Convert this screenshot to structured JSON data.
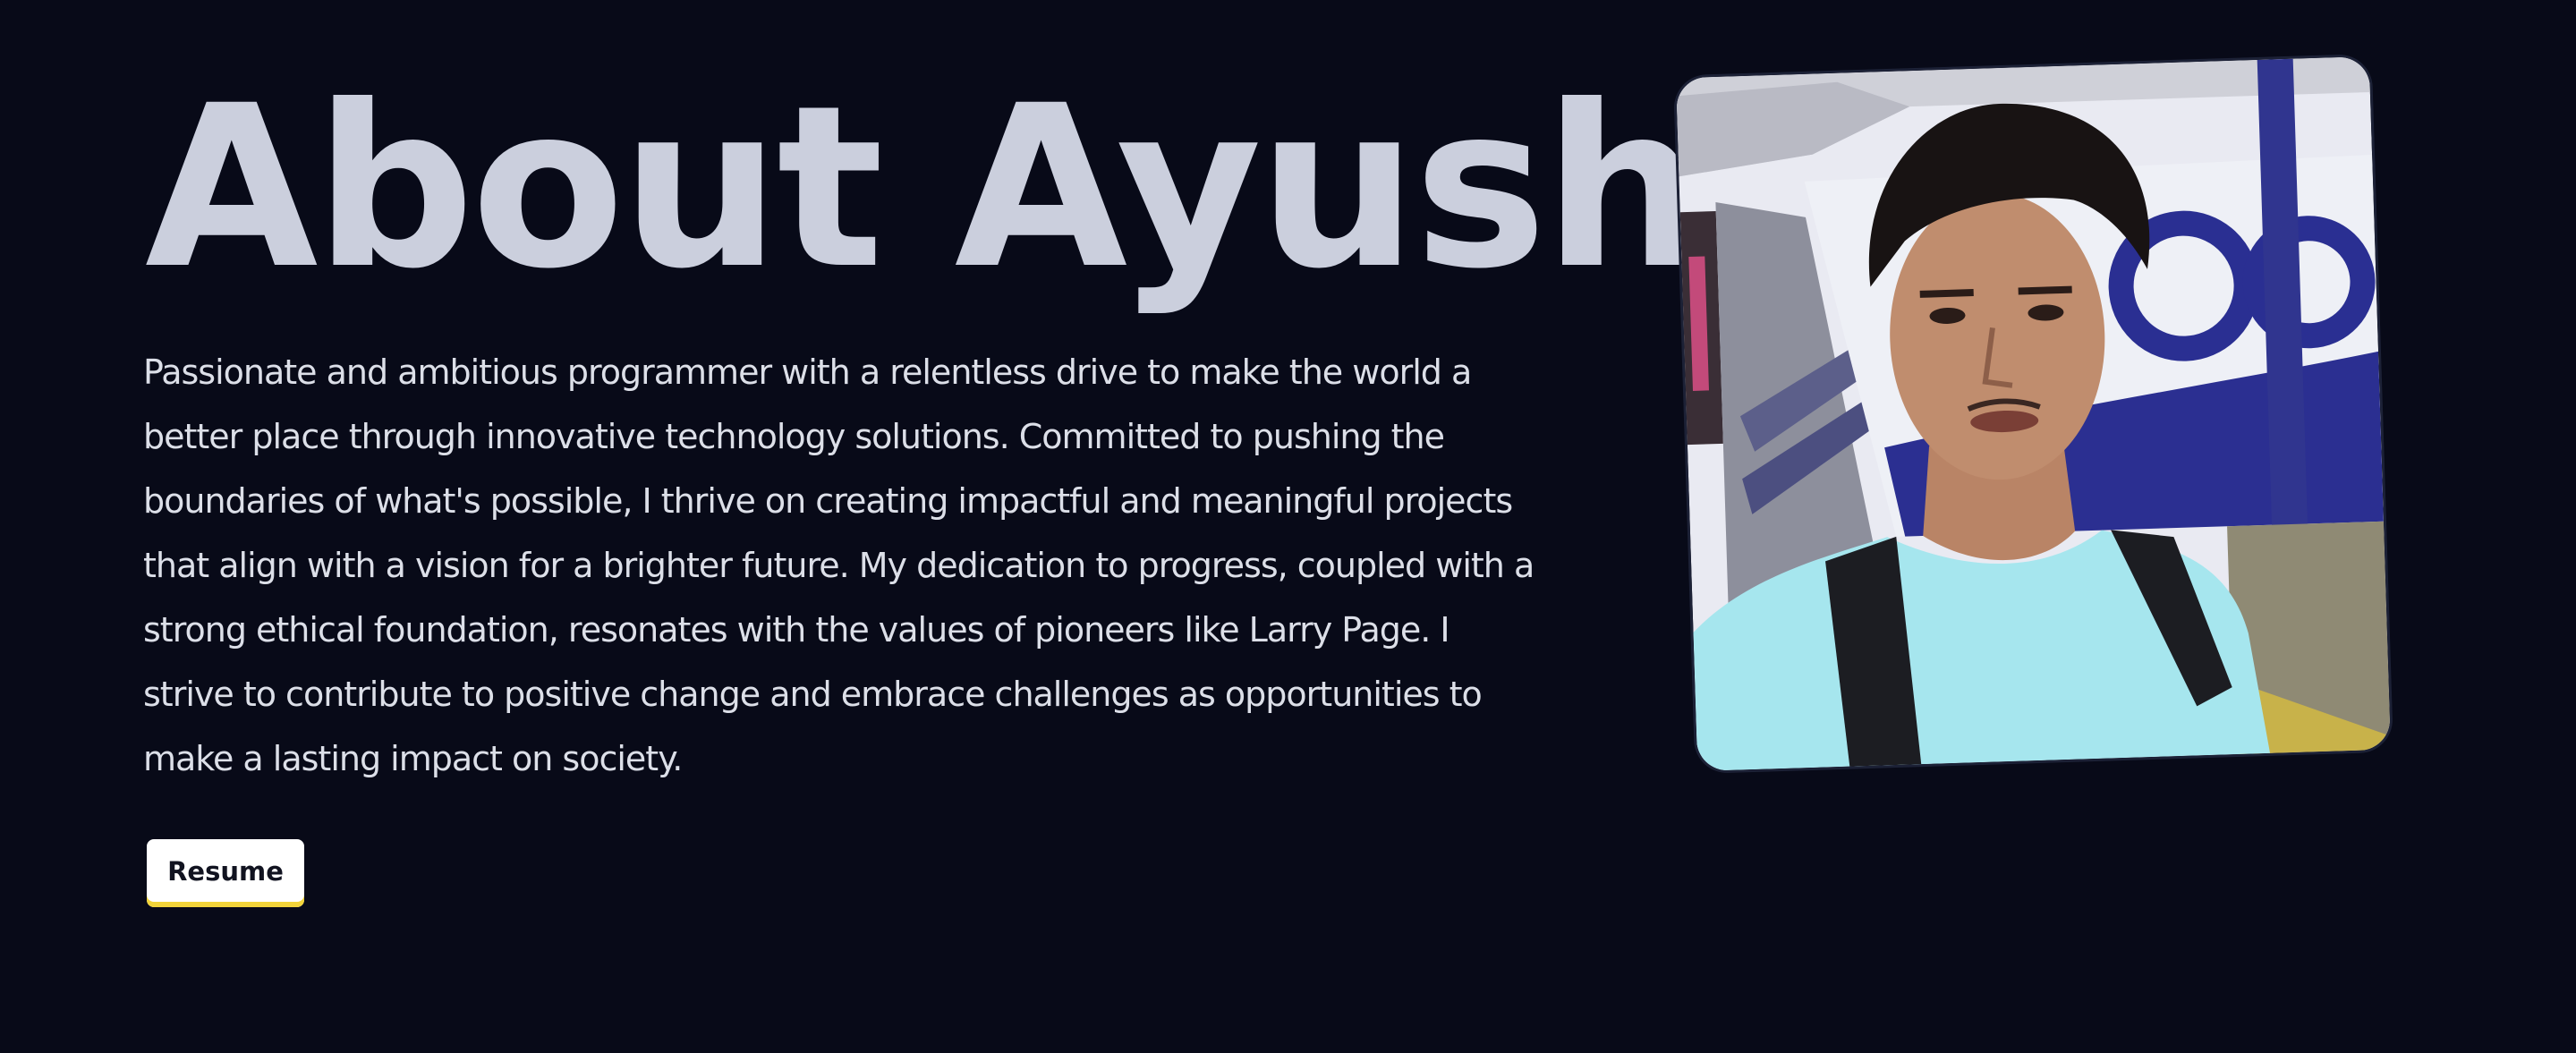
{
  "about": {
    "title": "About Ayush",
    "bio": "Passionate and ambitious programmer with a relentless drive to make the world a better place through innovative technology solutions. Committed to pushing the boundaries of what's possible, I thrive on creating impactful and meaningful projects that align with a vision for a brighter future. My dedication to progress, coupled with a strong ethical foundation, resonates with the values of pioneers like Larry Page. I strive to contribute to positive change and embrace challenges as opportunities to make a lasting impact on society.",
    "resume_label": "Resume"
  },
  "colors": {
    "background": "#080a18",
    "title": "#cbcfdd",
    "body_text": "#dcdfe8",
    "button_bg": "#ffffff",
    "button_accent": "#f2d43a"
  }
}
